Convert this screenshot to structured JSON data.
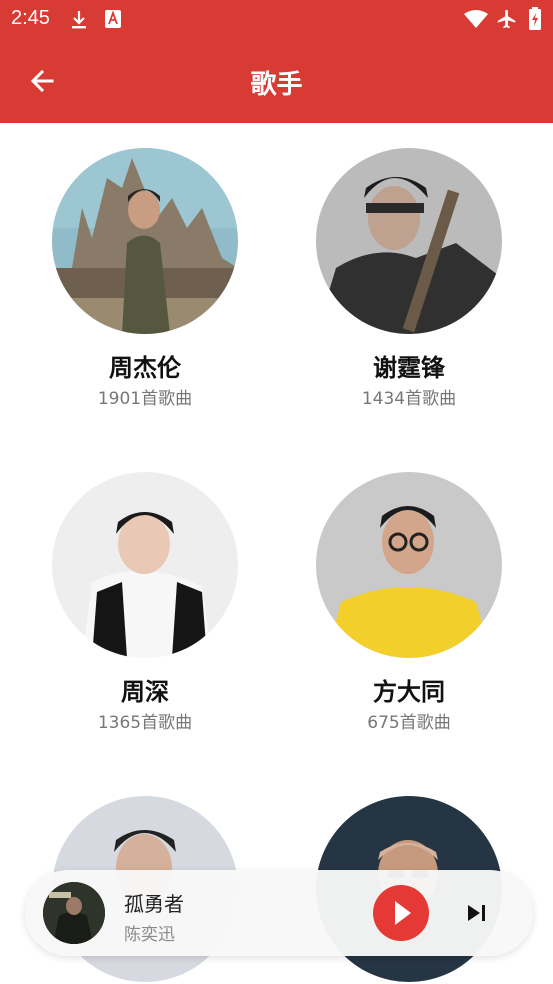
{
  "status_bar": {
    "time": "2:45",
    "icons": [
      "download-icon",
      "text-a-icon",
      "wifi-icon",
      "airplane-mode-icon",
      "battery-charging-icon"
    ]
  },
  "app_bar": {
    "title": "歌手",
    "back_icon": "arrow-left-icon"
  },
  "artists": [
    {
      "name": "周杰伦",
      "count": "1901首歌曲"
    },
    {
      "name": "谢霆锋",
      "count": "1434首歌曲"
    },
    {
      "name": "周深",
      "count": "1365首歌曲"
    },
    {
      "name": "方大同",
      "count": "675首歌曲"
    },
    {
      "name": "",
      "count": ""
    },
    {
      "name": "",
      "count": ""
    }
  ],
  "player": {
    "song": "孤勇者",
    "artist": "陈奕迅",
    "play_icon": "play-icon",
    "next_icon": "skip-next-icon"
  },
  "colors": {
    "brand": "#d83a34",
    "play": "#e53935"
  }
}
